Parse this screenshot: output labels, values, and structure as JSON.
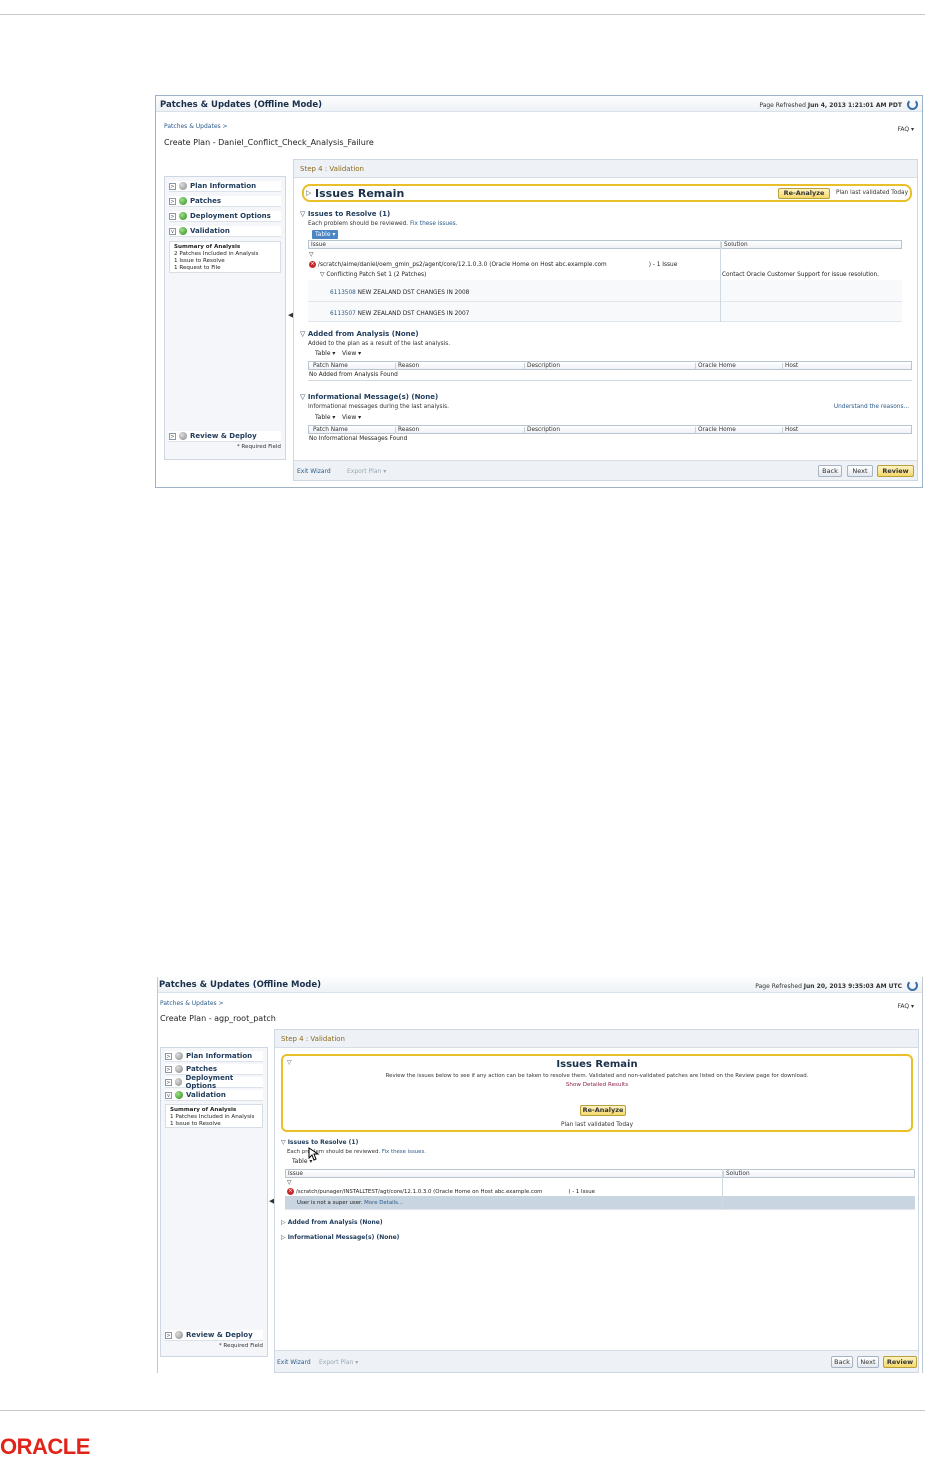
{
  "shot1": {
    "app_title": "Patches & Updates (Offline Mode)",
    "refreshed_label": "Page Refreshed",
    "refreshed_value": "Jun 4, 2013 1:21:01 AM PDT",
    "breadcrumb": "Patches & Updates >",
    "plan_title": "Create Plan - Daniel_Conflict_Check_Analysis_Failure",
    "faq": "FAQ ▾",
    "nav": [
      "Plan Information",
      "Patches",
      "Deployment Options",
      "Validation",
      "Review & Deploy"
    ],
    "summary": {
      "title": "Summary of Analysis",
      "lines": [
        "2 Patches Included in Analysis",
        "1 Issue to Resolve",
        "1 Request to File"
      ]
    },
    "required_field": "* Required Field",
    "step": "Step 4 : Validation",
    "issues_remain": "Issues Remain",
    "reanalyze": "Re-Analyze",
    "last_validated": "Plan last validated Today",
    "issues_to_resolve": "Issues to Resolve (1)",
    "issues_text": "Each problem should be reviewed.",
    "issues_link": "Fix these issues.",
    "table_btn": "Table ▾",
    "view_btn": "View ▾",
    "issue_columns": [
      "Issue",
      "Solution"
    ],
    "issue_path": "/scratch/aime/daniel/oem_gmin_ps2/agent/core/12.1.0.3.0 (Oracle Home on Host",
    "issue_host": "abc.example.com",
    "issue_count": ") - 1 Issue",
    "conflict_set": "Conflicting Patch Set 1 (2 Patches)",
    "solution_text": "Contact Oracle Customer Support for issue resolution.",
    "patch1_id": "6113508",
    "patch1_desc": "NEW ZEALAND DST CHANGES IN 2008",
    "patch2_id": "6113507",
    "patch2_desc": "NEW ZEALAND DST CHANGES IN 2007",
    "added_title": "Added from Analysis (None)",
    "added_text": "Added to the plan as a result of the last analysis.",
    "patch_columns": [
      "Patch Name",
      "Reason",
      "Description",
      "Oracle Home",
      "Host"
    ],
    "no_added": "No Added from Analysis Found",
    "info_title": "Informational Message(s) (None)",
    "info_text": "Informational messages during the last analysis.",
    "info_link": "Understand the reasons...",
    "no_info": "No Informational Messages Found",
    "exit_wizard": "Exit Wizard",
    "export_plan": "Export Plan ▾",
    "back": "Back",
    "next": "Next",
    "review": "Review"
  },
  "shot2": {
    "app_title": "Patches & Updates (Offline Mode)",
    "refreshed_label": "Page Refreshed",
    "refreshed_value": "Jun 20, 2013 9:35:03 AM UTC",
    "breadcrumb": "Patches & Updates >",
    "plan_title": "Create Plan - agp_root_patch",
    "faq": "FAQ ▾",
    "nav": [
      "Plan Information",
      "Patches",
      "Deployment Options",
      "Validation",
      "Review & Deploy"
    ],
    "summary": {
      "title": "Summary of Analysis",
      "lines": [
        "1 Patches Included in Analysis",
        "1 Issue to Resolve"
      ]
    },
    "required_field": "* Required Field",
    "step": "Step 4 : Validation",
    "issues_remain": "Issues Remain",
    "review_text": "Review the issues below to see if any action can be taken to resolve them. Validated and non-validated patches are listed on the Review page for download.",
    "show_results": "Show Detailed Results",
    "reanalyze": "Re-Analyze",
    "last_validated": "Plan last validated Today",
    "issues_to_resolve": "Issues to Resolve (1)",
    "issues_text": "Each problem should be reviewed.",
    "issues_link": "Fix these issues.",
    "table_btn": "Table ▾",
    "issue_columns": [
      "Issue",
      "Solution"
    ],
    "issue_path": "/scratch/punager/INSTALLTEST/agt/core/12.1.0.3.0 (Oracle Home on Host",
    "issue_host": "abc.example.com",
    "issue_count": ") - 1 Issue",
    "super_user": "User is not a super user.",
    "more_details": "More Details...",
    "added_title": "Added from Analysis (None)",
    "info_title": "Informational Message(s) (None)",
    "exit_wizard": "Exit Wizard",
    "export_plan": "Export Plan ▾",
    "back": "Back",
    "next": "Next",
    "review": "Review"
  },
  "footer": {
    "logo": "ORACLE",
    "logo_color": "#e2231a"
  }
}
